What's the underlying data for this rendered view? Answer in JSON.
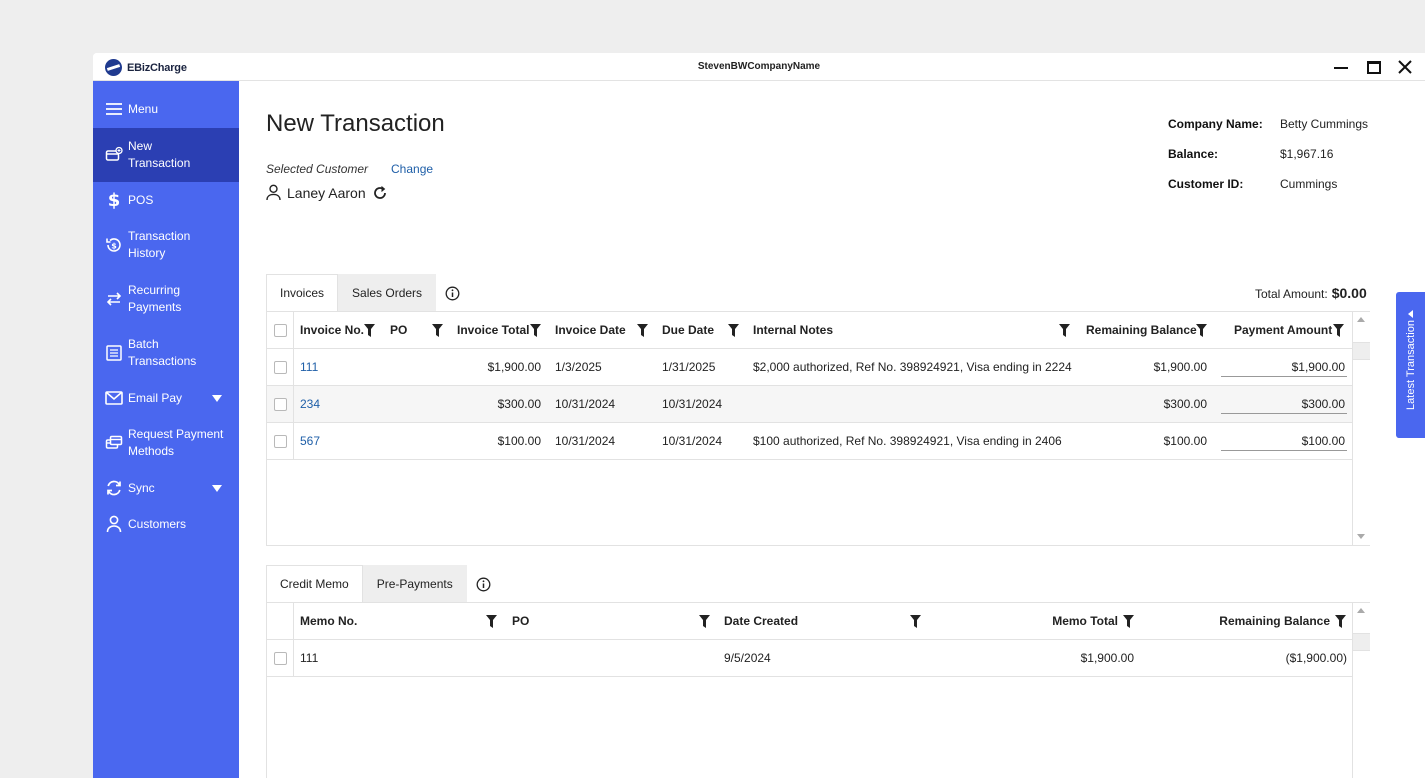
{
  "app": {
    "logo_text": "EBizCharge",
    "window_title": "StevenBWCompanyName"
  },
  "sidebar": {
    "items": [
      {
        "label": "Menu",
        "icon": "menu-icon"
      },
      {
        "label": "New\nTransaction",
        "icon": "new-transaction-icon",
        "active": true
      },
      {
        "label": "POS",
        "icon": "dollar-icon"
      },
      {
        "label": "Transaction\nHistory",
        "icon": "history-icon"
      },
      {
        "label": "Recurring\nPayments",
        "icon": "recurring-icon"
      },
      {
        "label": "Batch\nTransactions",
        "icon": "batch-icon"
      },
      {
        "label": "Email Pay",
        "icon": "email-icon",
        "caret": true
      },
      {
        "label": "Request Payment\nMethods",
        "icon": "request-payment-icon"
      },
      {
        "label": "Sync",
        "icon": "sync-icon",
        "caret": true
      },
      {
        "label": "Customers",
        "icon": "customer-icon"
      }
    ]
  },
  "header": {
    "title": "New Transaction",
    "selected_customer_label": "Selected Customer",
    "change_label": "Change",
    "customer_name": "Laney Aaron"
  },
  "info": {
    "company_label": "Company Name:",
    "company_value": "Betty Cummings",
    "balance_label": "Balance:",
    "balance_value": "$1,967.16",
    "customer_id_label": "Customer ID:",
    "customer_id_value": "Cummings"
  },
  "invoices": {
    "tabs": [
      "Invoices",
      "Sales Orders"
    ],
    "total_label": "Total Amount:",
    "total_value": "$0.00",
    "columns": {
      "invoice_no": "Invoice No.",
      "po": "PO",
      "invoice_total": "Invoice Total",
      "invoice_date": "Invoice Date",
      "due_date": "Due Date",
      "internal_notes": "Internal Notes",
      "remaining_balance": "Remaining Balance",
      "payment_amount": "Payment Amount"
    },
    "rows": [
      {
        "invoice_no": "111",
        "po": "",
        "invoice_total": "$1,900.00",
        "invoice_date": "1/3/2025",
        "due_date": "1/31/2025",
        "notes": "$2,000 authorized, Ref No. 398924921, Visa ending in 2224",
        "remaining": "$1,900.00",
        "payment": "$1,900.00"
      },
      {
        "invoice_no": "234",
        "po": "",
        "invoice_total": "$300.00",
        "invoice_date": "10/31/2024",
        "due_date": "10/31/2024",
        "notes": "",
        "remaining": "$300.00",
        "payment": "$300.00"
      },
      {
        "invoice_no": "567",
        "po": "",
        "invoice_total": "$100.00",
        "invoice_date": "10/31/2024",
        "due_date": "10/31/2024",
        "notes": "$100 authorized, Ref No. 398924921, Visa ending in 2406",
        "remaining": "$100.00",
        "payment": "$100.00"
      }
    ]
  },
  "credits": {
    "tabs": [
      "Credit Memo",
      "Pre-Payments"
    ],
    "columns": {
      "memo_no": "Memo No.",
      "po": "PO",
      "date_created": "Date Created",
      "memo_total": "Memo Total",
      "remaining_balance": "Remaining Balance"
    },
    "rows": [
      {
        "memo_no": "111",
        "po": "",
        "date_created": "9/5/2024",
        "memo_total": "$1,900.00",
        "remaining": "($1,900.00)"
      }
    ]
  },
  "latest_transaction_label": "Latest Transaction",
  "colors": {
    "sidebar": "#4a67ef",
    "sidebar_active": "#2b3fb3",
    "link": "#1f5fa8"
  }
}
